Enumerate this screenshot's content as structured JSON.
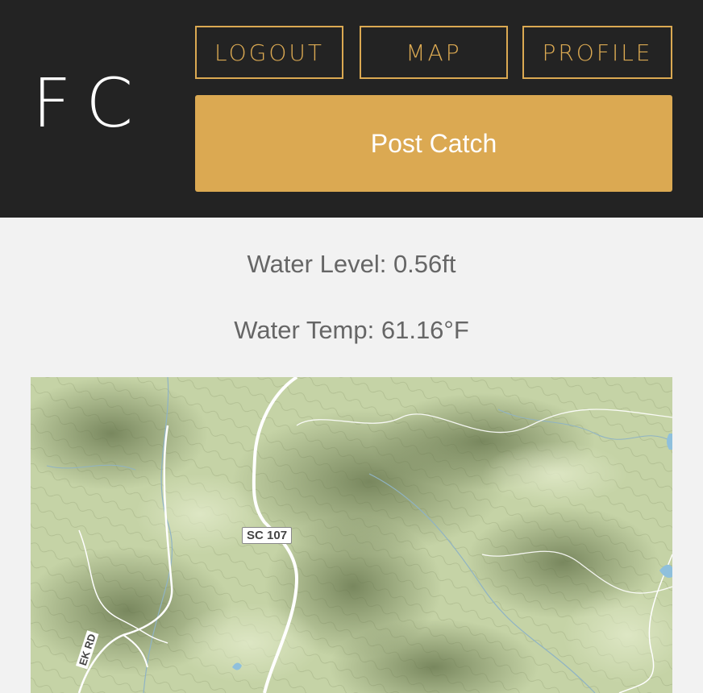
{
  "header": {
    "logo": "FC",
    "nav": {
      "logout": "LOGOUT",
      "map": "MAP",
      "profile": "PROFILE"
    },
    "post_catch": "Post Catch"
  },
  "readings": {
    "water_level": "Water Level: 0.56ft",
    "water_temp": "Water Temp: 61.16°F"
  },
  "map": {
    "road_label_1": "SC 107",
    "road_label_2": "EK RD"
  },
  "colors": {
    "header_bg": "#232323",
    "accent": "#dba952",
    "page_bg": "#f2f2f2",
    "text": "#666666",
    "map_base": "#c5d3a6"
  }
}
